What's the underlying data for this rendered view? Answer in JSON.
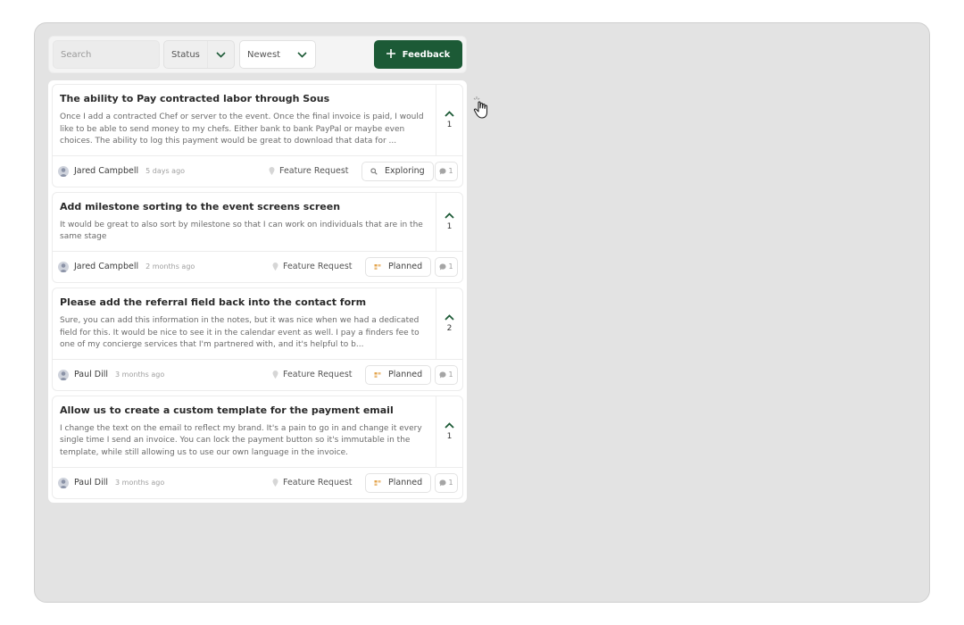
{
  "toolbar": {
    "search_placeholder": "Search",
    "status_label": "Status",
    "sort_label": "Newest",
    "feedback_button": "Feedback"
  },
  "posts": [
    {
      "title": "The ability to Pay contracted labor through Sous",
      "description": "Once I add a contracted Chef or server to the event. Once the final invoice is paid, I would like to be able to send money to my chefs. Either bank to bank PayPal or maybe even choices. The ability to log this payment would be great to download that data for ...",
      "votes": "1",
      "author": "Jared Campbell",
      "time": "5 days ago",
      "category": "Feature Request",
      "status": "Exploring",
      "comments": "1"
    },
    {
      "title": "Add milestone sorting to the event screens screen",
      "description": "It would be great to also sort by milestone so that I can work on individuals that are in the same stage",
      "votes": "1",
      "author": "Jared Campbell",
      "time": "2 months ago",
      "category": "Feature Request",
      "status": "Planned",
      "comments": "1"
    },
    {
      "title": "Please add the referral field back into the contact form",
      "description": "Sure, you can add this information in the notes, but it was nice when we had a dedicated field for this.  It would be nice to see it in the calendar event as well.  I pay a finders fee to one of my concierge services that I'm partnered with, and it's helpful to b...",
      "votes": "2",
      "author": "Paul Dill",
      "time": "3 months ago",
      "category": "Feature Request",
      "status": "Planned",
      "comments": "1"
    },
    {
      "title": "Allow us to create a custom template for the payment email",
      "description": "I change the text on the email to reflect my brand.  It's a pain to go in and change it every single time I send an invoice.  You can lock the payment button so it's immutable in the template, while still allowing us to use our own language in the invoice.",
      "votes": "1",
      "author": "Paul Dill",
      "time": "3 months ago",
      "category": "Feature Request",
      "status": "Planned",
      "comments": "1"
    }
  ],
  "colors": {
    "accent": "#1c5a36",
    "exploring": "#7a7a7a",
    "planned": "#e3a34a"
  }
}
